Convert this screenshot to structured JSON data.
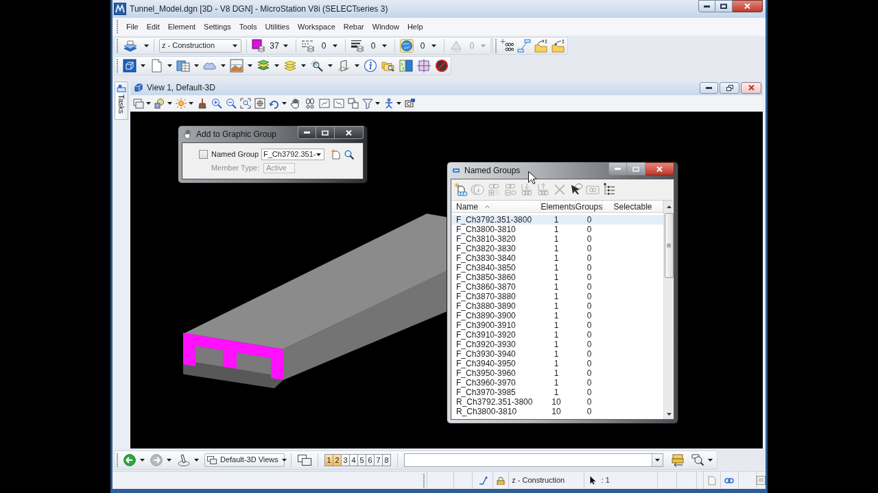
{
  "window": {
    "title": "Tunnel_Model.dgn [3D - V8 DGN] - MicroStation V8i (SELECTseries 3)"
  },
  "menu": [
    "File",
    "Edit",
    "Element",
    "Settings",
    "Tools",
    "Utilities",
    "Workspace",
    "Rebar",
    "Window",
    "Help"
  ],
  "attributes_toolbar": {
    "level_name": "z - Construction",
    "pickers": [
      {
        "kind": "swatch",
        "value": "37",
        "disabled": false
      },
      {
        "kind": "dashes",
        "value": "0",
        "disabled": false
      },
      {
        "kind": "lines",
        "value": "0",
        "disabled": false
      },
      {
        "kind": "globe",
        "value": "0",
        "disabled": false
      },
      {
        "kind": "triangle",
        "value": "0",
        "disabled": true
      }
    ]
  },
  "view": {
    "title": "View 1, Default-3D",
    "tasks_tab": "Tasks"
  },
  "add_to_graphic_group": {
    "title": "Add to Graphic Group",
    "named_group": {
      "label": "Named Group",
      "checked": false,
      "value": "F_Ch3792.351-"
    },
    "member_type": {
      "label": "Member Type:",
      "value": "Active",
      "disabled": true
    }
  },
  "named_groups": {
    "title": "Named Groups",
    "tools": [
      {
        "disabled": false
      },
      {
        "disabled": true
      },
      {
        "disabled": true
      },
      {
        "disabled": true
      },
      {
        "disabled": true
      },
      {
        "disabled": true
      },
      {
        "disabled": true
      },
      {
        "disabled": false
      },
      {
        "disabled": true
      },
      {
        "disabled": false
      }
    ],
    "columns": [
      {
        "label": "Name",
        "sorted": true
      },
      {
        "label": "Elements",
        "sorted": false
      },
      {
        "label": "Groups",
        "sorted": false
      },
      {
        "label": "Selectable",
        "sorted": false
      }
    ],
    "rows": [
      {
        "name": "F_Ch3792.351-3800",
        "elements": "1",
        "groups": "0",
        "selected": true
      },
      {
        "name": "F_Ch3800-3810",
        "elements": "1",
        "groups": "0",
        "selected": false
      },
      {
        "name": "F_Ch3810-3820",
        "elements": "1",
        "groups": "0",
        "selected": false
      },
      {
        "name": "F_Ch3820-3830",
        "elements": "1",
        "groups": "0",
        "selected": false
      },
      {
        "name": "F_Ch3830-3840",
        "elements": "1",
        "groups": "0",
        "selected": false
      },
      {
        "name": "F_Ch3840-3850",
        "elements": "1",
        "groups": "0",
        "selected": false
      },
      {
        "name": "F_Ch3850-3860",
        "elements": "1",
        "groups": "0",
        "selected": false
      },
      {
        "name": "F_Ch3860-3870",
        "elements": "1",
        "groups": "0",
        "selected": false
      },
      {
        "name": "F_Ch3870-3880",
        "elements": "1",
        "groups": "0",
        "selected": false
      },
      {
        "name": "F_Ch3880-3890",
        "elements": "1",
        "groups": "0",
        "selected": false
      },
      {
        "name": "F_Ch3890-3900",
        "elements": "1",
        "groups": "0",
        "selected": false
      },
      {
        "name": "F_Ch3900-3910",
        "elements": "1",
        "groups": "0",
        "selected": false
      },
      {
        "name": "F_Ch3910-3920",
        "elements": "1",
        "groups": "0",
        "selected": false
      },
      {
        "name": "F_Ch3920-3930",
        "elements": "1",
        "groups": "0",
        "selected": false
      },
      {
        "name": "F_Ch3930-3940",
        "elements": "1",
        "groups": "0",
        "selected": false
      },
      {
        "name": "F_Ch3940-3950",
        "elements": "1",
        "groups": "0",
        "selected": false
      },
      {
        "name": "F_Ch3950-3960",
        "elements": "1",
        "groups": "0",
        "selected": false
      },
      {
        "name": "F_Ch3960-3970",
        "elements": "1",
        "groups": "0",
        "selected": false
      },
      {
        "name": "F_Ch3970-3985",
        "elements": "1",
        "groups": "0",
        "selected": false
      },
      {
        "name": "R_Ch3792.351-3800",
        "elements": "10",
        "groups": "0",
        "selected": false
      },
      {
        "name": "R_Ch3800-3810",
        "elements": "10",
        "groups": "0",
        "selected": false
      }
    ]
  },
  "view_bar": {
    "nav": [
      {
        "kind": "left",
        "disabled": false
      },
      {
        "kind": "right",
        "disabled": true
      }
    ],
    "views_dropdown": "Default-3D Views",
    "views": [
      {
        "label": "1",
        "on": true
      },
      {
        "label": "2",
        "on": true
      },
      {
        "label": "3",
        "on": false
      },
      {
        "label": "4",
        "on": false
      },
      {
        "label": "5",
        "on": false
      },
      {
        "label": "6",
        "on": false
      },
      {
        "label": "7",
        "on": false
      },
      {
        "label": "8",
        "on": false
      }
    ]
  },
  "status_bar": {
    "level_name": "z - Construction",
    "selection": ": 1"
  }
}
